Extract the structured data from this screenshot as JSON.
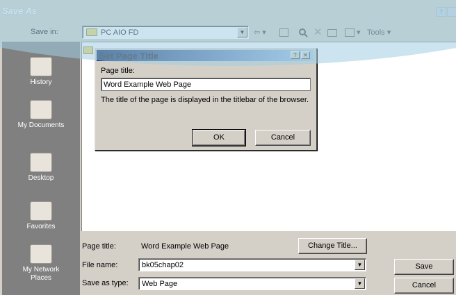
{
  "window": {
    "title": "Save As"
  },
  "save_in": {
    "label": "Save in:",
    "value": "PC AIO FD"
  },
  "toolbar": {
    "back": "⇦",
    "tools_label": "Tools"
  },
  "places": [
    {
      "label": "History"
    },
    {
      "label": "My Documents"
    },
    {
      "label": "Desktop"
    },
    {
      "label": "Favorites"
    },
    {
      "label": "My Network Places"
    }
  ],
  "page_title_row": {
    "label": "Page title:",
    "value": "Word Example Web Page",
    "change_button": "Change Title..."
  },
  "file_name_row": {
    "label": "File name:",
    "value": "bk05chap02"
  },
  "save_as_type_row": {
    "label": "Save as type:",
    "value": "Web Page"
  },
  "buttons": {
    "save": "Save",
    "cancel": "Cancel"
  },
  "dialog": {
    "title": "Set Page Title",
    "field_label": "Page title:",
    "field_value": "Word Example Web Page",
    "description": "The title of the page is displayed in the titlebar of the browser.",
    "ok": "OK",
    "cancel": "Cancel"
  }
}
